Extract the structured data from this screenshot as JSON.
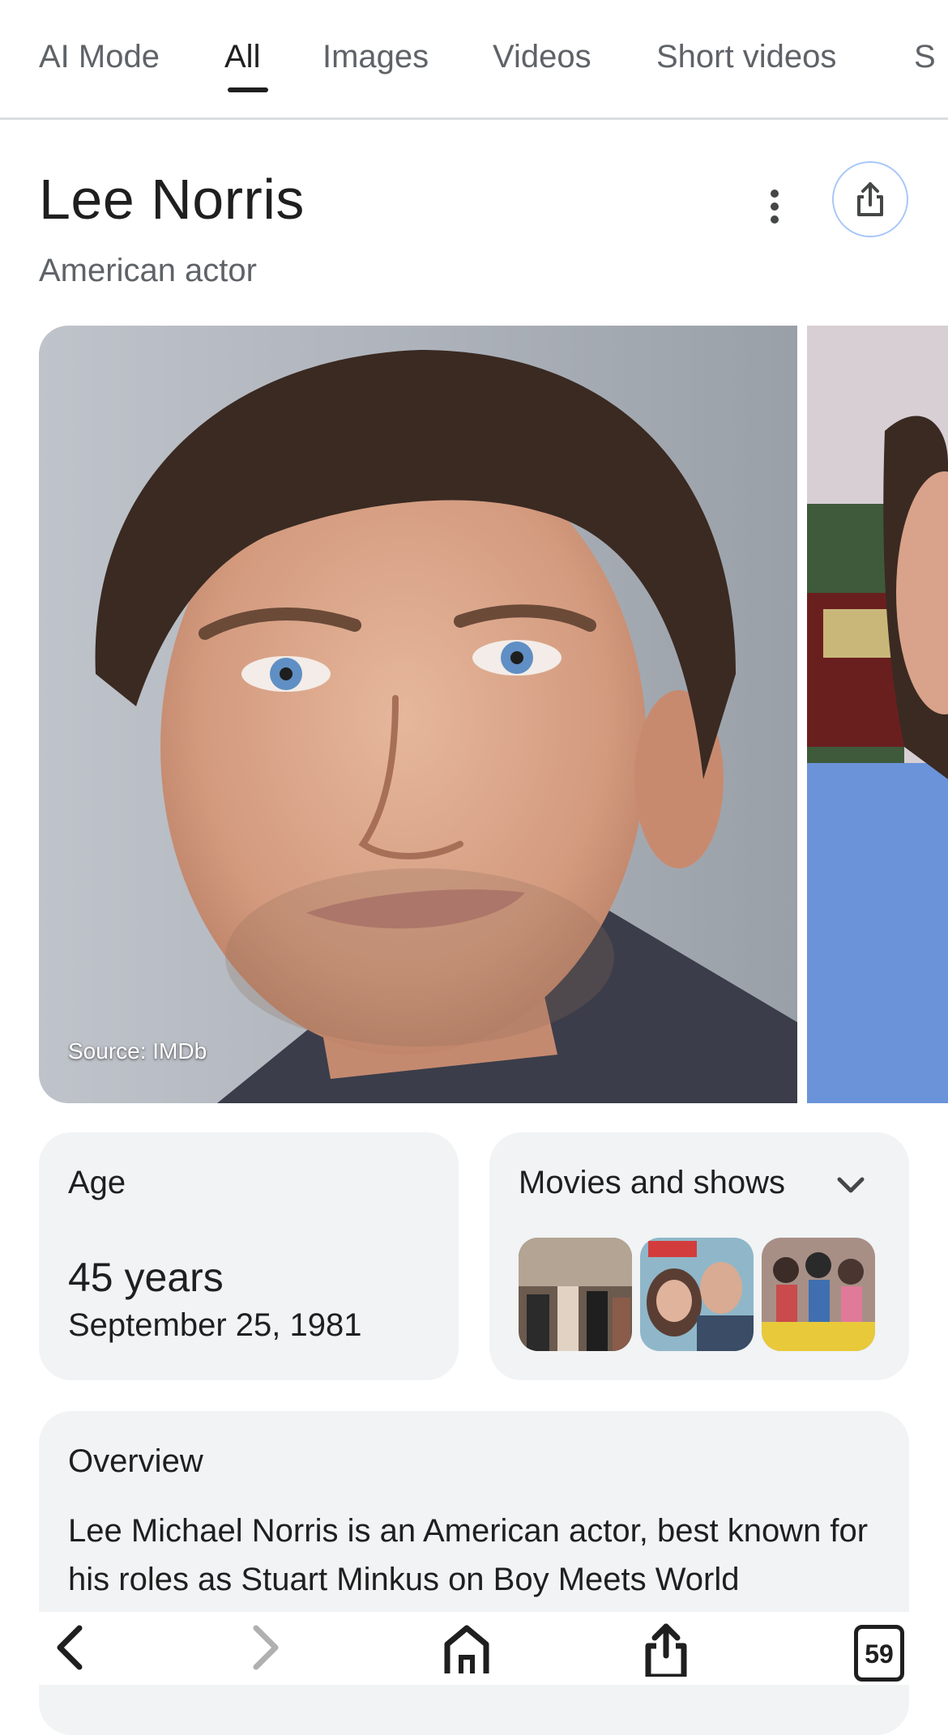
{
  "tabs": [
    {
      "label": "AI Mode"
    },
    {
      "label": "All"
    },
    {
      "label": "Images"
    },
    {
      "label": "Videos"
    },
    {
      "label": "Short videos"
    },
    {
      "label": "S"
    }
  ],
  "knowledge_panel": {
    "title": "Lee Norris",
    "subtitle": "American actor",
    "image_source": "Source: IMDb",
    "age": {
      "label": "Age",
      "value": "45 years",
      "birth_date": "September 25, 1981"
    },
    "movies": {
      "label": "Movies and shows"
    },
    "overview": {
      "title": "Overview",
      "text": "Lee Michael Norris is an American actor, best known for his roles as Stuart Minkus on Boy Meets World"
    }
  },
  "bottom_bar": {
    "tab_count": "59"
  },
  "colors": {
    "accent_ring": "#a8c7fa",
    "card_bg": "#f1f3f4",
    "text_primary": "#1f1f1f",
    "text_secondary": "#5f6368"
  },
  "icons": [
    "more-vert-icon",
    "share-icon",
    "chevron-down-icon",
    "back-icon",
    "forward-icon",
    "home-icon",
    "share-upload-icon",
    "tab-switcher-icon"
  ]
}
